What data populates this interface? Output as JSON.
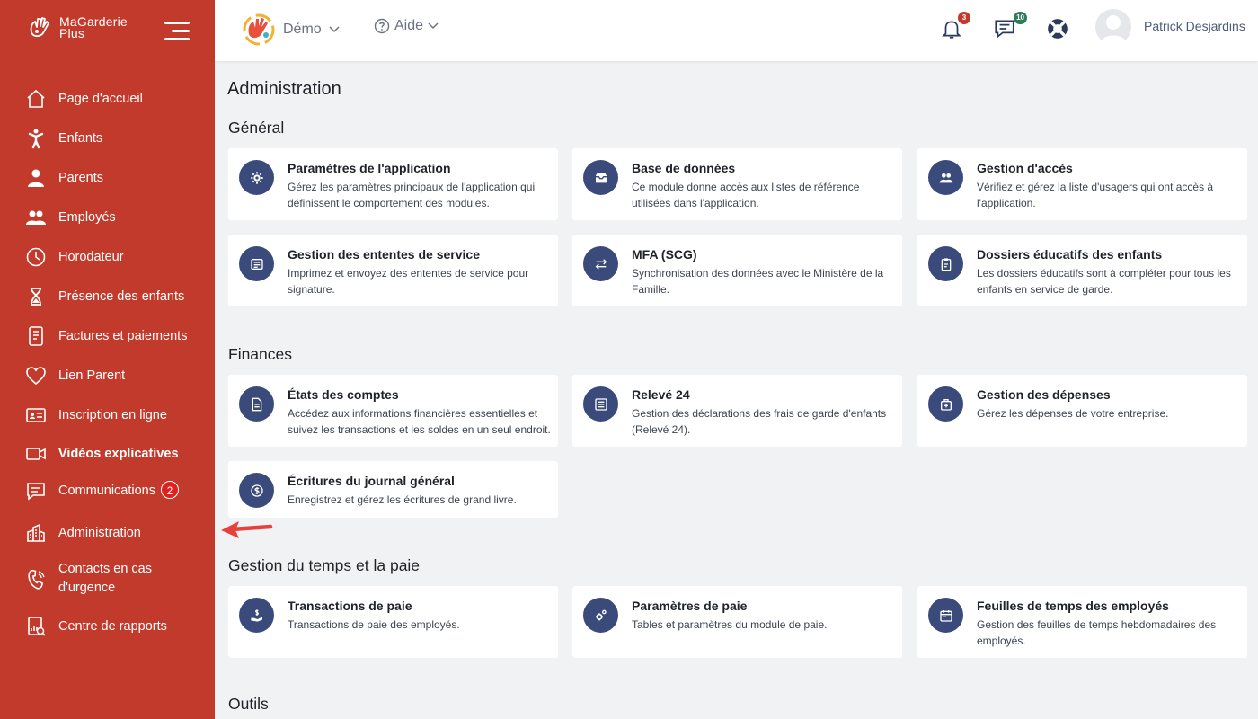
{
  "sidebar": {
    "logo_line1": "MaGarderie",
    "logo_line2": "Plus",
    "items": [
      {
        "label": "Page d'accueil"
      },
      {
        "label": "Enfants"
      },
      {
        "label": "Parents"
      },
      {
        "label": "Employés"
      },
      {
        "label": "Horodateur"
      },
      {
        "label": "Présence des enfants"
      },
      {
        "label": "Factures et paiements"
      },
      {
        "label": "Lien Parent"
      },
      {
        "label": "Inscription en ligne"
      },
      {
        "label": "Vidéos explicatives"
      },
      {
        "label": "Communications",
        "badge": "2"
      },
      {
        "label": "Administration"
      },
      {
        "label": "Contacts en cas d'urgence"
      },
      {
        "label": "Centre de rapports"
      }
    ]
  },
  "header": {
    "org_label": "Démo",
    "help_label": "Aide",
    "notifications_count": "3",
    "messages_count": "10",
    "user_name": "Patrick Desjardins"
  },
  "main": {
    "page_title": "Administration",
    "sections": [
      {
        "title": "Général",
        "cards": [
          {
            "title": "Paramètres de l'application",
            "desc": "Gérez les paramètres principaux de l'application qui définissent le comportement des modules."
          },
          {
            "title": "Base de données",
            "desc": "Ce module donne accès aux listes de référence utilisées dans l'application."
          },
          {
            "title": "Gestion d'accès",
            "desc": "Vérifiez et gérez la liste d'usagers qui ont accès à l'application."
          },
          {
            "title": "Gestion des ententes de service",
            "desc": "Imprimez et envoyez des ententes de service pour signature."
          },
          {
            "title": "MFA (SCG)",
            "desc": "Synchronisation des données avec le Ministère de la Famille."
          },
          {
            "title": "Dossiers éducatifs des enfants",
            "desc": "Les dossiers éducatifs sont à compléter pour tous les enfants en service de garde."
          }
        ]
      },
      {
        "title": "Finances",
        "cards": [
          {
            "title": "États des comptes",
            "desc": "Accédez aux informations financières essentielles et suivez les transactions et les soldes en un seul endroit."
          },
          {
            "title": "Relevé 24",
            "desc": "Gestion des déclarations des frais de garde d'enfants (Relevé 24)."
          },
          {
            "title": "Gestion des dépenses",
            "desc": "Gérez les dépenses de votre entreprise."
          },
          {
            "title": "Écritures du journal général",
            "desc": "Enregistrez et gérez les écritures de grand livre."
          }
        ]
      },
      {
        "title": "Gestion du temps et la paie",
        "cards": [
          {
            "title": "Transactions de paie",
            "desc": "Transactions de paie des employés."
          },
          {
            "title": "Paramètres de paie",
            "desc": "Tables et paramètres du module de paie."
          },
          {
            "title": "Feuilles de temps des employés",
            "desc": "Gestion des feuilles de temps hebdomadaires des employés."
          }
        ]
      },
      {
        "title": "Outils",
        "cards": []
      }
    ]
  },
  "colors": {
    "sidebar_bg": "#c23a2b",
    "card_icon_bg": "#3a4a7a",
    "badge_red": "#e0201e",
    "badge_green": "#2e7d5a",
    "page_bg": "#f1f2f4"
  }
}
